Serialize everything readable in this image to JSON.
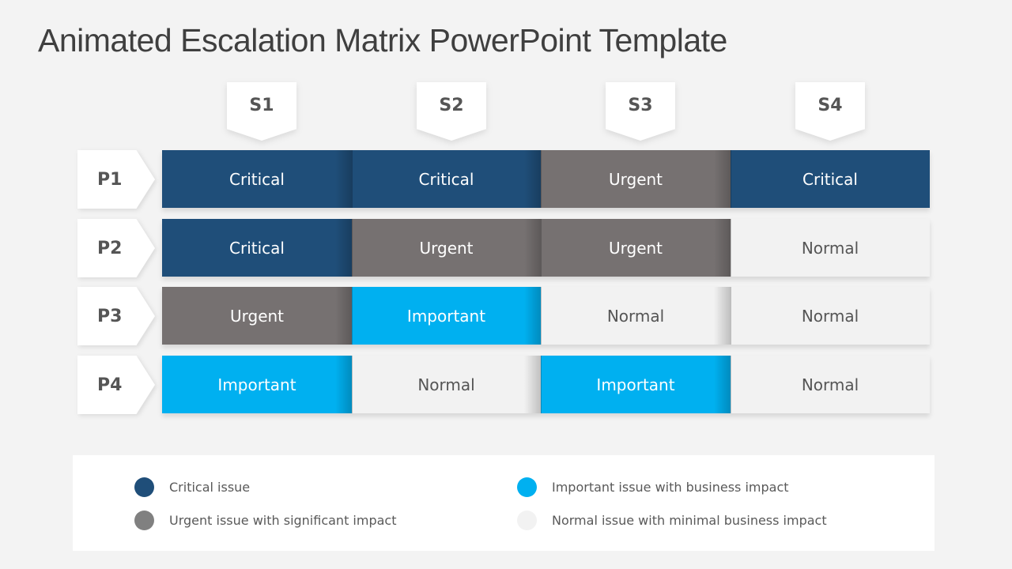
{
  "title": "Animated Escalation Matrix PowerPoint Template",
  "colors": {
    "critical": "#1f4e79",
    "urgent": "#767171",
    "important": "#00b0f0",
    "normal": "#f2f2f2"
  },
  "columns": [
    "S1",
    "S2",
    "S3",
    "S4"
  ],
  "rows": [
    {
      "label": "P1",
      "cells": [
        {
          "text": "Critical",
          "level": "critical"
        },
        {
          "text": "Critical",
          "level": "critical"
        },
        {
          "text": "Urgent",
          "level": "urgent"
        },
        {
          "text": "Critical",
          "level": "critical"
        }
      ]
    },
    {
      "label": "P2",
      "cells": [
        {
          "text": "Critical",
          "level": "critical"
        },
        {
          "text": "Urgent",
          "level": "urgent"
        },
        {
          "text": "Urgent",
          "level": "urgent"
        },
        {
          "text": "Normal",
          "level": "normal"
        }
      ]
    },
    {
      "label": "P3",
      "cells": [
        {
          "text": "Urgent",
          "level": "urgent"
        },
        {
          "text": "Important",
          "level": "important"
        },
        {
          "text": "Normal",
          "level": "normal"
        },
        {
          "text": "Normal",
          "level": "normal"
        }
      ]
    },
    {
      "label": "P4",
      "cells": [
        {
          "text": "Important",
          "level": "important"
        },
        {
          "text": "Normal",
          "level": "normal"
        },
        {
          "text": "Important",
          "level": "important"
        },
        {
          "text": "Normal",
          "level": "normal"
        }
      ]
    }
  ],
  "legend": [
    {
      "level": "critical",
      "color": "#1f4e79",
      "label": "Critical issue"
    },
    {
      "level": "urgent",
      "color": "#808080",
      "label": "Urgent issue with significant impact"
    },
    {
      "level": "important",
      "color": "#00b0f0",
      "label": "Important issue with business impact"
    },
    {
      "level": "normal",
      "color": "#f2f2f2",
      "label": "Normal issue with minimal business impact"
    }
  ]
}
